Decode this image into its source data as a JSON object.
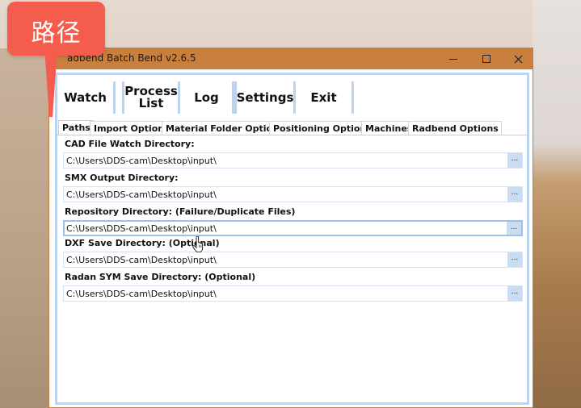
{
  "callout": {
    "text": "路径"
  },
  "window": {
    "title": "Radbend Batch Bend v2.6.5",
    "title_visible": "adbend Batch Bend v2.6.5",
    "controls": {
      "minimize": "—",
      "maximize": "☐",
      "close": "✕"
    }
  },
  "toolbar": {
    "watch": "Watch",
    "process_list": "Process\nList",
    "log": "Log",
    "settings": "Settings",
    "exit": "Exit"
  },
  "tabs": [
    {
      "label": "Paths",
      "active": true
    },
    {
      "label": "Import Options",
      "active": false
    },
    {
      "label": "Material Folder Options",
      "active": false
    },
    {
      "label": "Positioning Options",
      "active": false
    },
    {
      "label": "Machines",
      "active": false
    },
    {
      "label": "Radbend Options",
      "active": false
    }
  ],
  "paths": {
    "cad_watch": {
      "label": "CAD File Watch Directory:",
      "value": "C:\\Users\\DDS-cam\\Desktop\\input\\"
    },
    "smx_output": {
      "label": "SMX Output Directory:",
      "value": "C:\\Users\\DDS-cam\\Desktop\\input\\"
    },
    "repository": {
      "label": "Repository Directory: (Failure/Duplicate Files)",
      "value": "C:\\Users\\DDS-cam\\Desktop\\input\\"
    },
    "dxf_save": {
      "label": "DXF Save Directory: (Optional)",
      "value": "C:\\Users\\DDS-cam\\Desktop\\input\\"
    },
    "radan_sym": {
      "label": "Radan SYM Save Directory: (Optional)",
      "value": "C:\\Users\\DDS-cam\\Desktop\\input\\"
    }
  },
  "browse_label": "...",
  "icons": {
    "cursor": "hand-pointer-icon"
  },
  "colors": {
    "titlebar": "#c9803e",
    "callout": "#f45d4d",
    "accent_border": "#bcd3ee"
  }
}
